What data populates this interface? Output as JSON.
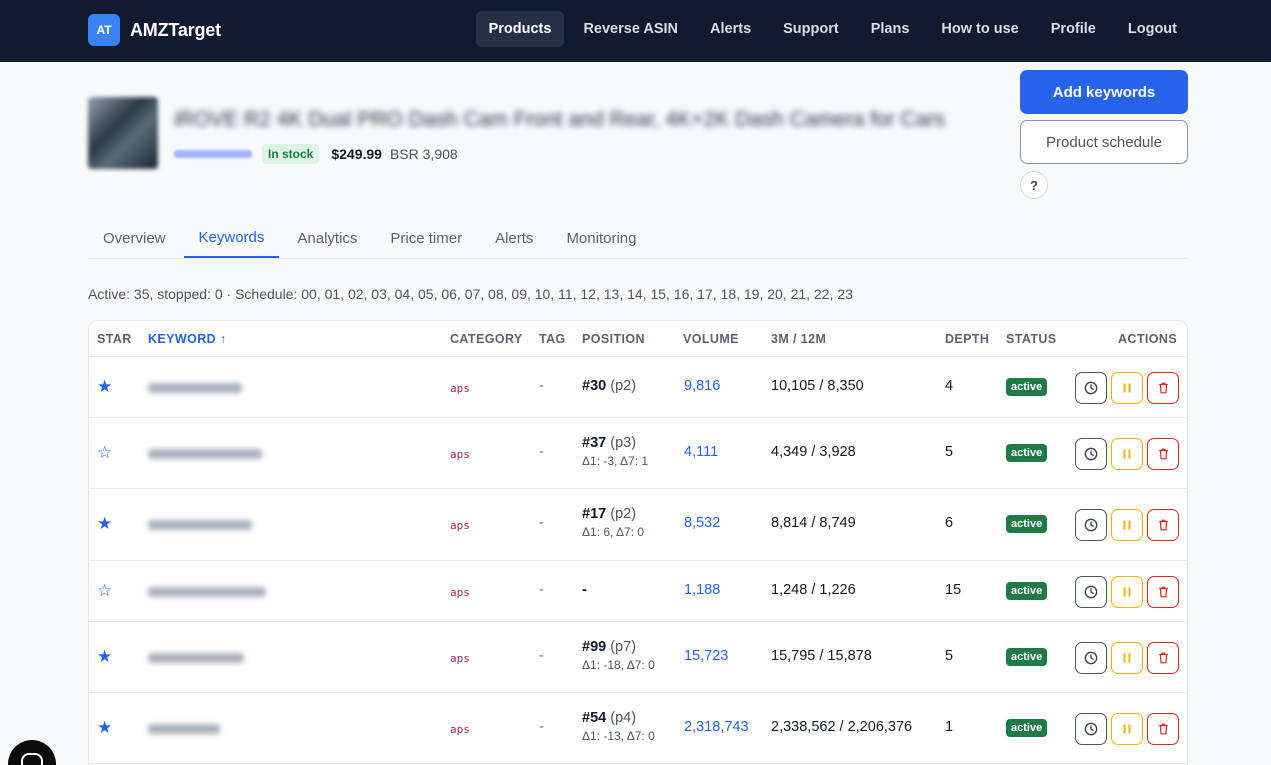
{
  "brand": {
    "badge": "AT",
    "name": "AMZTarget"
  },
  "nav": [
    {
      "label": "Products",
      "active": true
    },
    {
      "label": "Reverse ASIN"
    },
    {
      "label": "Alerts"
    },
    {
      "label": "Support"
    },
    {
      "label": "Plans"
    },
    {
      "label": "How to use"
    },
    {
      "label": "Profile"
    },
    {
      "label": "Logout"
    }
  ],
  "product": {
    "title": "iROVE R2 4K Dual PRO Dash Cam Front and Rear, 4K+2K Dash Camera for Cars",
    "stock": "In stock",
    "price": "$249.99",
    "bsr": "BSR 3,908"
  },
  "buttons": {
    "add_keywords": "Add keywords",
    "product_schedule": "Product schedule",
    "help": "?"
  },
  "tabs": [
    "Overview",
    "Keywords",
    "Analytics",
    "Price timer",
    "Alerts",
    "Monitoring"
  ],
  "active_tab": "Keywords",
  "summary": "Active: 35, stopped: 0 · Schedule: 00, 01, 02, 03, 04, 05, 06, 07, 08, 09, 10, 11, 12, 13, 14, 15, 16, 17, 18, 19, 20, 21, 22, 23",
  "table": {
    "headers": {
      "star": "STAR",
      "keyword": "KEYWORD ↑",
      "category": "CATEGORY",
      "tag": "TAG",
      "position": "POSITION",
      "volume": "VOLUME",
      "trend": "3M / 12M",
      "depth": "DEPTH",
      "status": "STATUS",
      "actions": "ACTIONS"
    },
    "rows": [
      {
        "star": "★",
        "category": "aps",
        "tag": "-",
        "position": "#30",
        "page": "(p2)",
        "delta": "",
        "volume": "9,816",
        "trend": "10,105 / 8,350",
        "depth": "4",
        "status": "active"
      },
      {
        "star": "☆",
        "category": "aps",
        "tag": "-",
        "position": "#37",
        "page": "(p3)",
        "delta": "Δ1: -3, Δ7: 1",
        "volume": "4,111",
        "trend": "4,349 / 3,928",
        "depth": "5",
        "status": "active"
      },
      {
        "star": "★",
        "category": "aps",
        "tag": "-",
        "position": "#17",
        "page": "(p2)",
        "delta": "Δ1: 6, Δ7: 0",
        "volume": "8,532",
        "trend": "8,814 / 8,749",
        "depth": "6",
        "status": "active"
      },
      {
        "star": "☆",
        "category": "aps",
        "tag": "-",
        "position": "-",
        "page": "",
        "delta": "",
        "volume": "1,188",
        "trend": "1,248 / 1,226",
        "depth": "15",
        "status": "active"
      },
      {
        "star": "★",
        "category": "aps",
        "tag": "-",
        "position": "#99",
        "page": "(p7)",
        "delta": "Δ1: -18, Δ7: 0",
        "volume": "15,723",
        "trend": "15,795 / 15,878",
        "depth": "5",
        "status": "active"
      },
      {
        "star": "★",
        "category": "aps",
        "tag": "-",
        "position": "#54",
        "page": "(p4)",
        "delta": "Δ1: -13, Δ7: 0",
        "volume": "2,318,743",
        "trend": "2,338,562 / 2,206,376",
        "depth": "1",
        "status": "active"
      }
    ]
  },
  "colors": {
    "nav_bg": "#111a2e",
    "accent": "#2563eb",
    "status_active": "#1f7a45",
    "pause": "#eab308",
    "delete": "#dc2626"
  },
  "icons": {
    "clock": "clock-icon",
    "pause": "pause-icon",
    "trash": "trash-icon"
  }
}
